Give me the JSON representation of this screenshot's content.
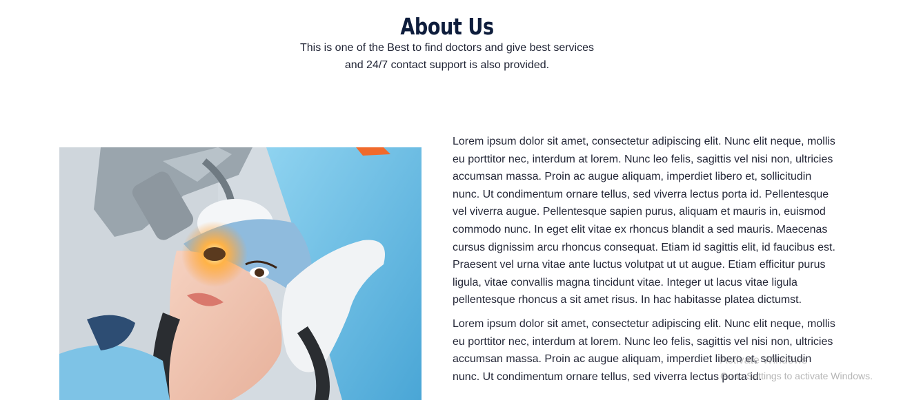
{
  "section": {
    "title": "About Us",
    "subtitle_line1": "This is one of the Best to find doctors and give best services",
    "subtitle_line2": "and 24/7 contact support is also provided."
  },
  "image": {
    "icon": "eye-surgery-photo"
  },
  "content": {
    "paragraph1": "Lorem ipsum dolor sit amet, consectetur adipiscing elit. Nunc elit neque, mollis eu porttitor nec, interdum at lorem. Nunc leo felis, sagittis vel nisi non, ultricies accumsan massa. Proin ac augue aliquam, imperdiet libero et, sollicitudin nunc. Ut condimentum ornare tellus, sed viverra lectus porta id. Pellentesque vel viverra augue. Pellentesque sapien purus, aliquam et mauris in, euismod commodo nunc. In eget elit vitae ex rhoncus blandit a sed mauris. Maecenas cursus dignissim arcu rhoncus consequat. Etiam id sagittis elit, id faucibus est. Praesent vel urna vitae ante luctus volutpat ut ut augue. Etiam efficitur purus ligula, vitae convallis magna tincidunt vitae. Integer ut lacus vitae ligula pellentesque rhoncus a sit amet risus. In hac habitasse platea dictumst.",
    "paragraph2": "Lorem ipsum dolor sit amet, consectetur adipiscing elit. Nunc elit neque, mollis eu porttitor nec, interdum at lorem. Nunc leo felis, sagittis vel nisi non, ultricies accumsan massa. Proin ac augue aliquam, imperdiet libero et, sollicitudin nunc. Ut condimentum ornare tellus, sed viverra lectus porta id."
  },
  "overlay": {
    "line1": "Activate Windows",
    "line2": "Go to Settings to activate Windows."
  },
  "colors": {
    "heading": "#0e1d3c",
    "body_text": "#252838",
    "scrub_blue": "#5fb8e0"
  }
}
